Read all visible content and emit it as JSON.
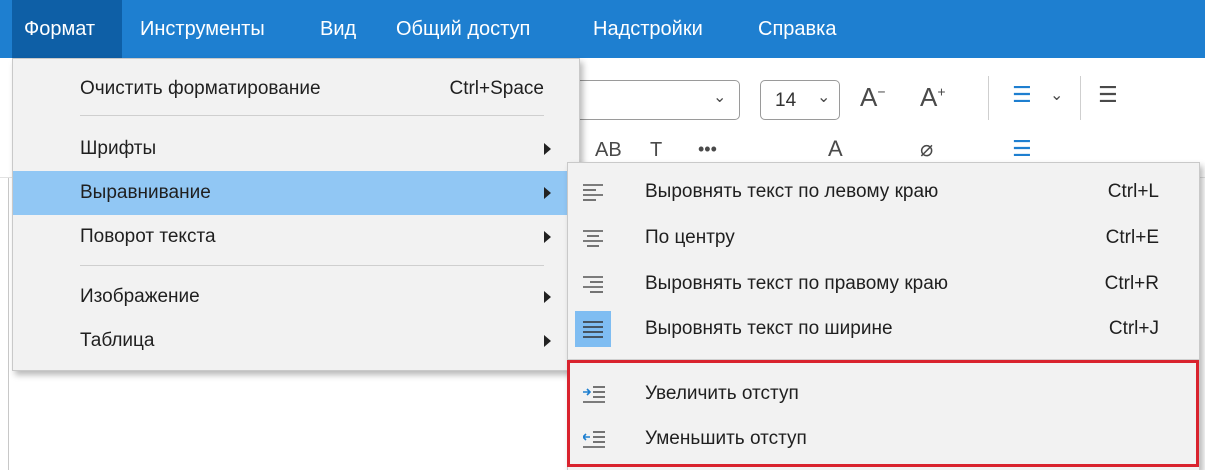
{
  "menubar": {
    "items": [
      "Формат",
      "Инструменты",
      "Вид",
      "Общий доступ",
      "Надстройки",
      "Справка"
    ],
    "active_index": 0
  },
  "toolbar": {
    "font_size": "14"
  },
  "format_menu": {
    "clear_formatting": {
      "label": "Очистить форматирование",
      "shortcut": "Ctrl+Space"
    },
    "items": [
      {
        "label": "Шрифты",
        "has_submenu": true
      },
      {
        "label": "Выравнивание",
        "has_submenu": true,
        "highlighted": true
      },
      {
        "label": "Поворот текста",
        "has_submenu": true
      },
      {
        "label": "Изображение",
        "has_submenu": true
      },
      {
        "label": "Таблица",
        "has_submenu": true
      }
    ]
  },
  "align_submenu": {
    "items": [
      {
        "label": "Выровнять текст по левому краю",
        "shortcut": "Ctrl+L",
        "icon": "align-left-icon"
      },
      {
        "label": "По центру",
        "shortcut": "Ctrl+E",
        "icon": "align-center-icon"
      },
      {
        "label": "Выровнять текст по правому краю",
        "shortcut": "Ctrl+R",
        "icon": "align-right-icon"
      },
      {
        "label": "Выровнять текст по ширине",
        "shortcut": "Ctrl+J",
        "icon": "align-justify-icon",
        "selected": true
      },
      {
        "label": "Увеличить отступ",
        "shortcut": "",
        "icon": "indent-increase-icon"
      },
      {
        "label": "Уменьшить отступ",
        "shortcut": "",
        "icon": "indent-decrease-icon"
      }
    ]
  },
  "colors": {
    "menubar_bg": "#1e7fd0",
    "menubar_active": "#0e5fa6",
    "menu_highlight": "#91c7f4",
    "selected_icon_bg": "#7fbdf2",
    "annotation_box": "#d9232e"
  }
}
